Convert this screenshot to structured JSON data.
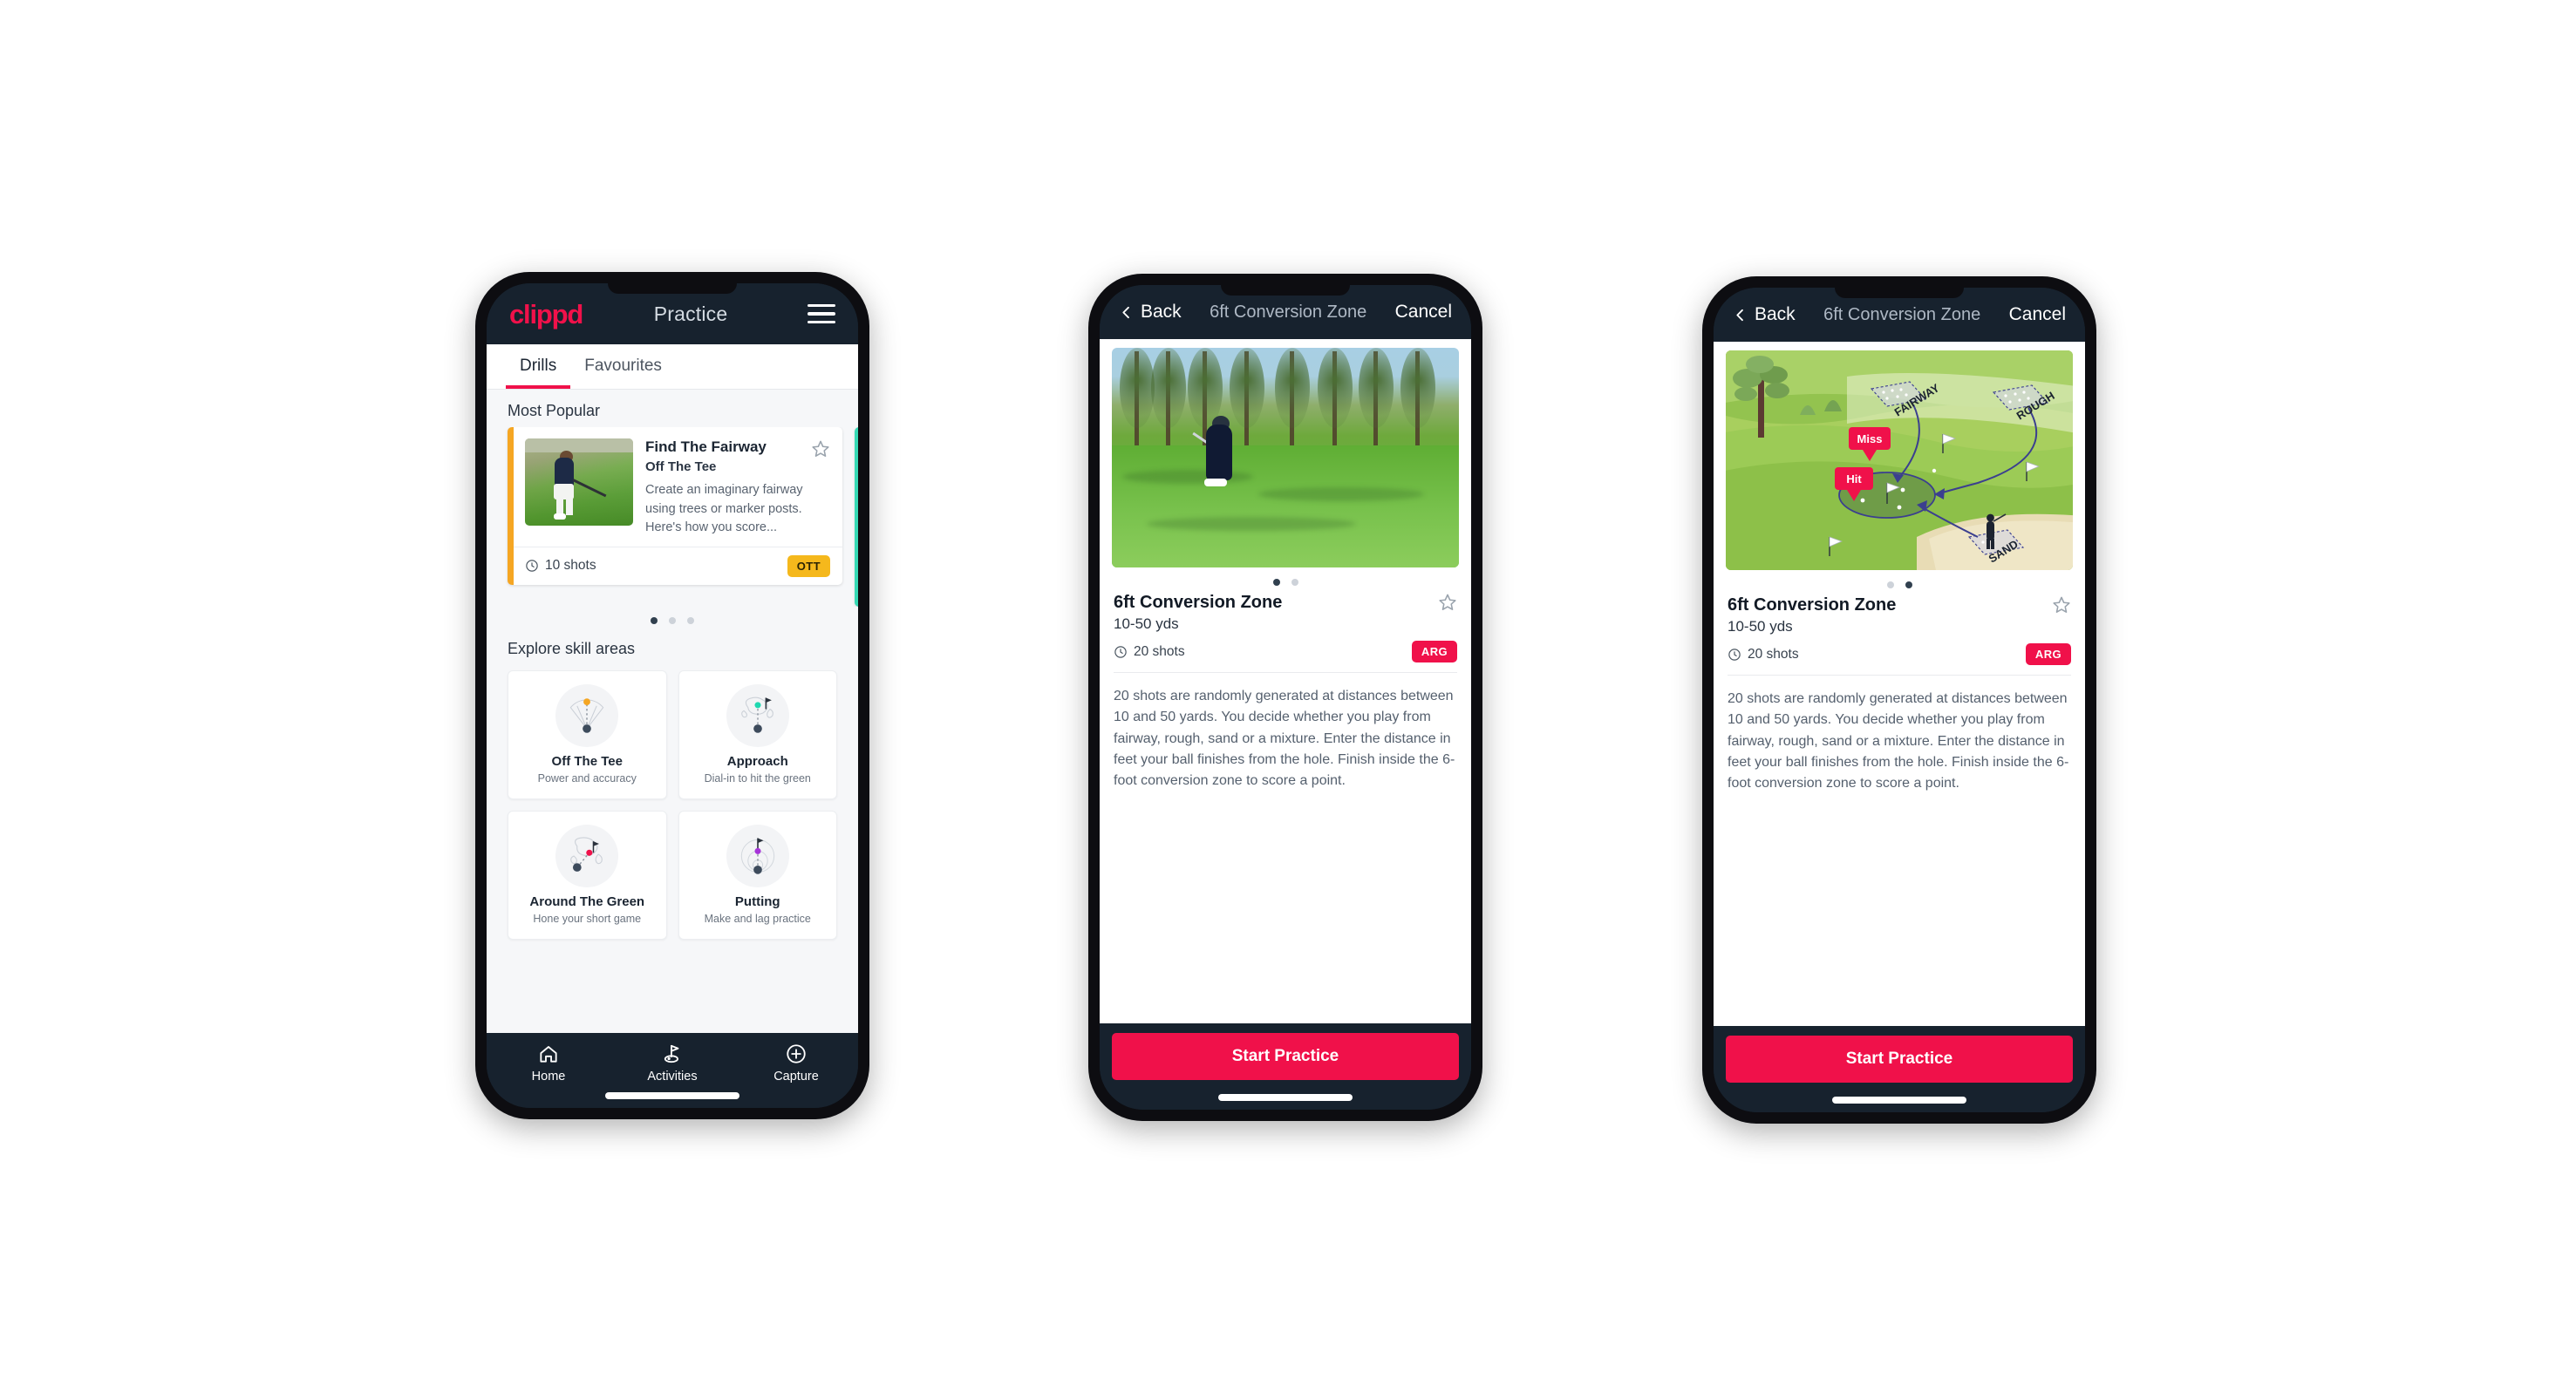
{
  "phone1": {
    "topbar": {
      "logo": "clippd",
      "title": "Practice",
      "menu_icon": "hamburger-menu-icon"
    },
    "tabs": [
      {
        "label": "Drills",
        "active": true
      },
      {
        "label": "Favourites",
        "active": false
      }
    ],
    "most_popular": {
      "section_label": "Most Popular",
      "card": {
        "title": "Find The Fairway",
        "subtitle": "Off The Tee",
        "description": "Create an imaginary fairway using trees or marker posts. Here's how you score...",
        "shots": "10 shots",
        "badge": "OTT",
        "accent_color": "#f5a623",
        "badge_color": "#f5b81c",
        "star_icon": "star-outline-icon",
        "clock_icon": "clock-icon"
      },
      "peek_card_accent": "#35d9b4",
      "dots": [
        true,
        false,
        false
      ]
    },
    "skills": {
      "section_label": "Explore skill areas",
      "items": [
        {
          "name": "Off The Tee",
          "desc": "Power and accuracy",
          "icon": "tee-dispersion-icon",
          "dot_color": "#f5a623"
        },
        {
          "name": "Approach",
          "desc": "Dial-in to hit the green",
          "icon": "approach-green-icon",
          "dot_color": "#1fd8b0"
        },
        {
          "name": "Around The Green",
          "desc": "Hone your short game",
          "icon": "around-green-icon",
          "dot_color": "#f0114a"
        },
        {
          "name": "Putting",
          "desc": "Make and lag practice",
          "icon": "putting-rings-icon",
          "dot_color": "#a734d9"
        }
      ]
    },
    "nav": [
      {
        "label": "Home",
        "icon": "home-icon",
        "active": false
      },
      {
        "label": "Activities",
        "icon": "golf-flag-icon",
        "active": true
      },
      {
        "label": "Capture",
        "icon": "plus-circle-icon",
        "active": false
      }
    ]
  },
  "phone2": {
    "topbar": {
      "back": "Back",
      "title": "6ft Conversion Zone",
      "cancel": "Cancel",
      "back_icon": "chevron-left-icon"
    },
    "media_type": "photo-golfer-chipping",
    "dots": [
      true,
      false
    ],
    "detail": {
      "name": "6ft Conversion Zone",
      "yards": "10-50 yds",
      "shots": "20 shots",
      "badge": "ARG",
      "badge_color": "#f0114a",
      "star_icon": "star-outline-icon",
      "clock_icon": "clock-icon",
      "description": "20 shots are randomly generated at distances between 10 and 50 yards. You decide whether you play from fairway, rough, sand or a mixture. Enter the distance in feet your ball finishes from the hole. Finish inside the 6-foot conversion zone to score a point."
    },
    "footer": {
      "start_label": "Start Practice",
      "start_color": "#f0114a"
    }
  },
  "phone3": {
    "topbar": {
      "back": "Back",
      "title": "6ft Conversion Zone",
      "cancel": "Cancel",
      "back_icon": "chevron-left-icon"
    },
    "media_type": "course-diagram",
    "diagram": {
      "labels": [
        "FAIRWAY",
        "ROUGH",
        "SAND"
      ],
      "markers": [
        "Miss",
        "Hit"
      ],
      "marker_color": "#f0114a"
    },
    "dots": [
      false,
      true
    ],
    "detail": {
      "name": "6ft Conversion Zone",
      "yards": "10-50 yds",
      "shots": "20 shots",
      "badge": "ARG",
      "badge_color": "#f0114a",
      "star_icon": "star-outline-icon",
      "clock_icon": "clock-icon",
      "description": "20 shots are randomly generated at distances between 10 and 50 yards. You decide whether you play from fairway, rough, sand or a mixture. Enter the distance in feet your ball finishes from the hole. Finish inside the 6-foot conversion zone to score a point."
    },
    "footer": {
      "start_label": "Start Practice",
      "start_color": "#f0114a"
    }
  }
}
